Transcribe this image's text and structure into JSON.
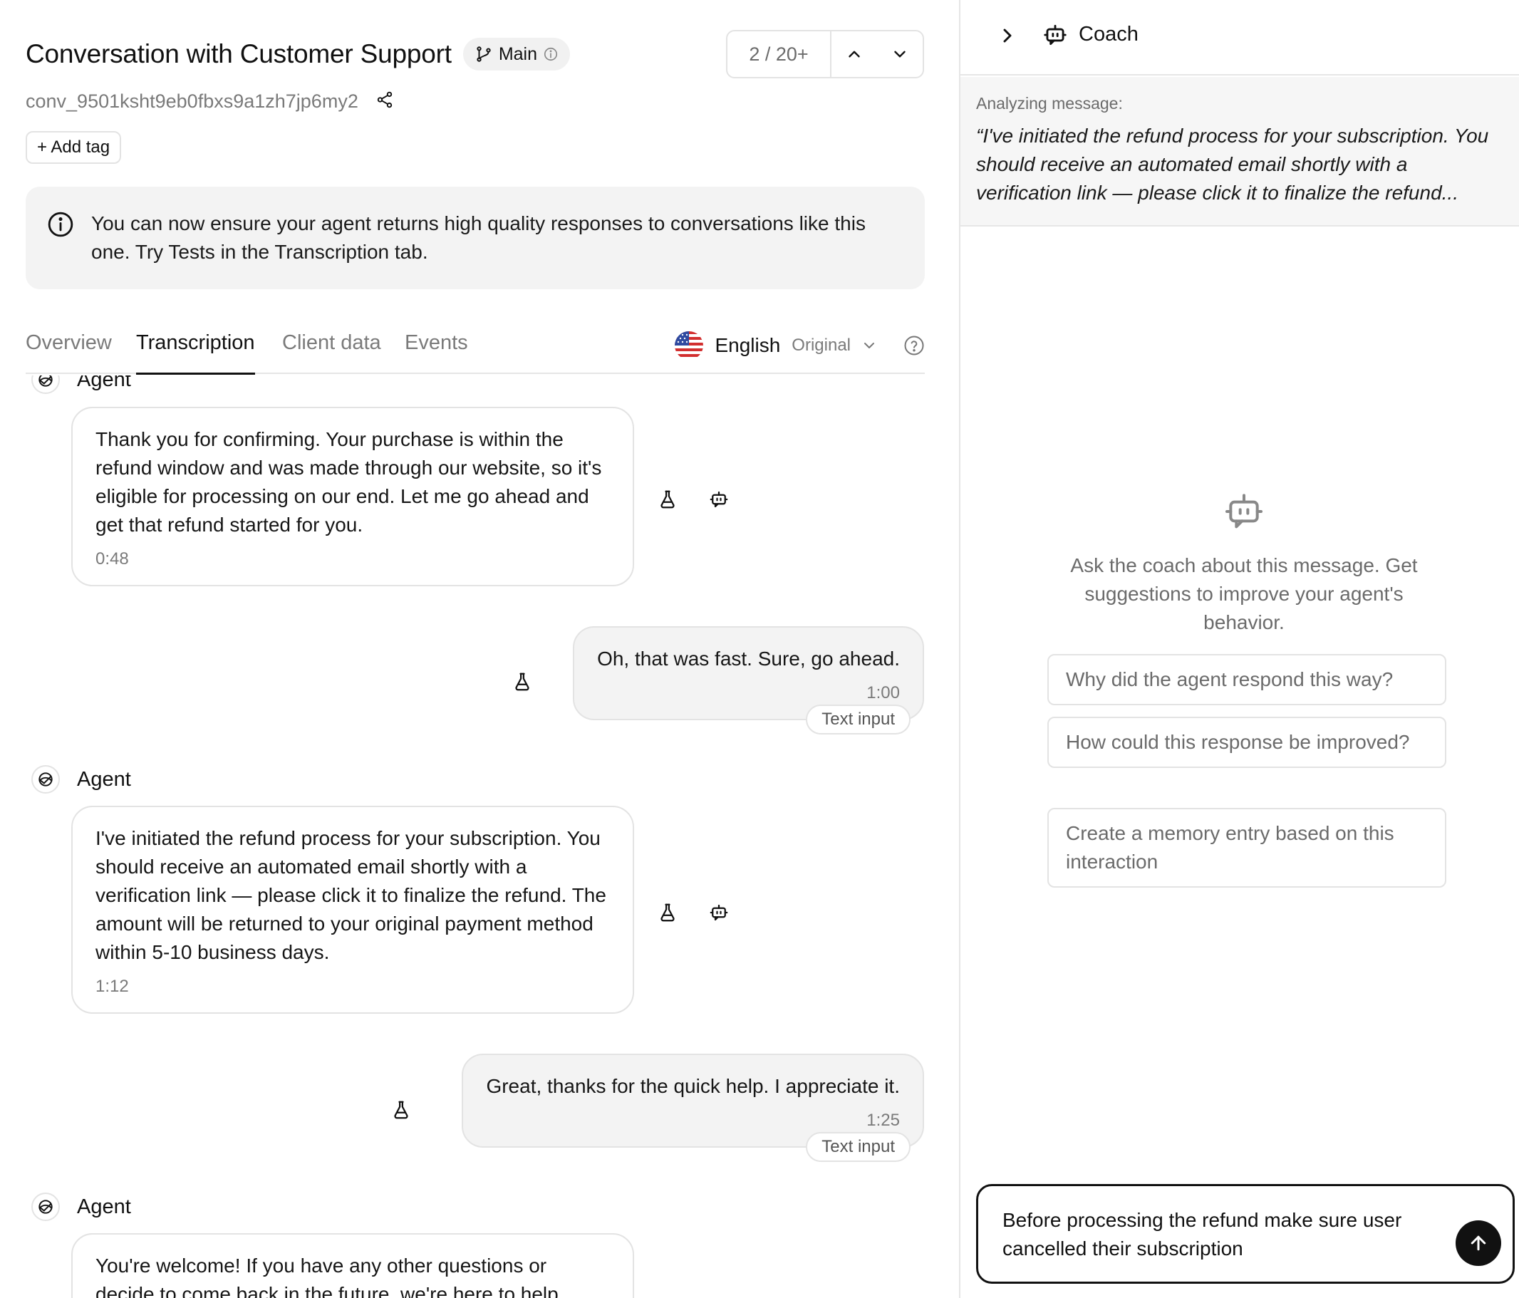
{
  "header": {
    "title": "Conversation with  Customer Support",
    "branch_label": "Main",
    "pager_count": "2 / 20+",
    "conversation_id": "conv_9501ksht9eb0fbxs9a1zh7jp6my2",
    "add_tag_label": "+ Add tag"
  },
  "banner": {
    "text": "You can now ensure your agent returns high quality responses to conversations like this one. Try Tests in the Transcription tab."
  },
  "tabs": [
    {
      "label": "Overview"
    },
    {
      "label": "Transcription"
    },
    {
      "label": "Client data"
    },
    {
      "label": "Events"
    }
  ],
  "active_tab": "Transcription",
  "language": {
    "name": "English",
    "mode": "Original"
  },
  "messages": [
    {
      "role": "agent",
      "sender": "Agent",
      "text": "Thank you for confirming. Your  purchase is within the refund window and was made through our website, so it's eligible for processing on our end. Let me go ahead and get that refund started for you.",
      "time": "0:48"
    },
    {
      "role": "user",
      "text": "Oh, that was fast. Sure, go ahead.",
      "time": "1:00",
      "source": "Text input"
    },
    {
      "role": "agent",
      "sender": "Agent",
      "text": "I've initiated the refund process for your subscription. You should receive an automated email shortly with a verification link — please click it to finalize the refund. The amount will be returned to your original payment method within 5-10 business days.",
      "time": "1:12"
    },
    {
      "role": "user",
      "text": "Great, thanks for the quick help. I appreciate it.",
      "time": "1:25",
      "source": "Text input"
    },
    {
      "role": "agent",
      "sender": "Agent",
      "text": "You're welcome! If you have any other questions or decide to come back in the future, we're here to help."
    }
  ],
  "coach": {
    "title": "Coach",
    "analyzing_label": "Analyzing message:",
    "analyzing_quote": "“I've initiated the refund process for your subscription. You should receive an automated email shortly with a verification link — please click it to finalize the refund...",
    "empty_text": "Ask the coach about this message. Get suggestions to improve your agent's behavior.",
    "suggestions": [
      "Why did the agent respond this way?",
      "How could this response be improved?",
      "Create a memory entry based on this interaction"
    ],
    "composer_value": "Before processing the refund make sure user cancelled their subscription"
  },
  "icons": {
    "branch": "git-branch-icon",
    "info": "info-icon",
    "chevron_up": "chevron-up-icon",
    "chevron_down": "chevron-down-icon",
    "share": "share-icon",
    "flag": "us-flag-icon",
    "help": "help-circle-icon",
    "agent_avatar": "agent-avatar-icon",
    "test": "flask-icon",
    "coach": "bot-icon",
    "collapse": "chevron-right-icon",
    "send": "arrow-up-icon"
  },
  "colors": {
    "accent": "#111111",
    "muted_text": "#7a7a7a",
    "banner_bg": "#f3f3f3",
    "user_bubble_bg": "#f3f3f3",
    "border": "#e3e3e3"
  }
}
